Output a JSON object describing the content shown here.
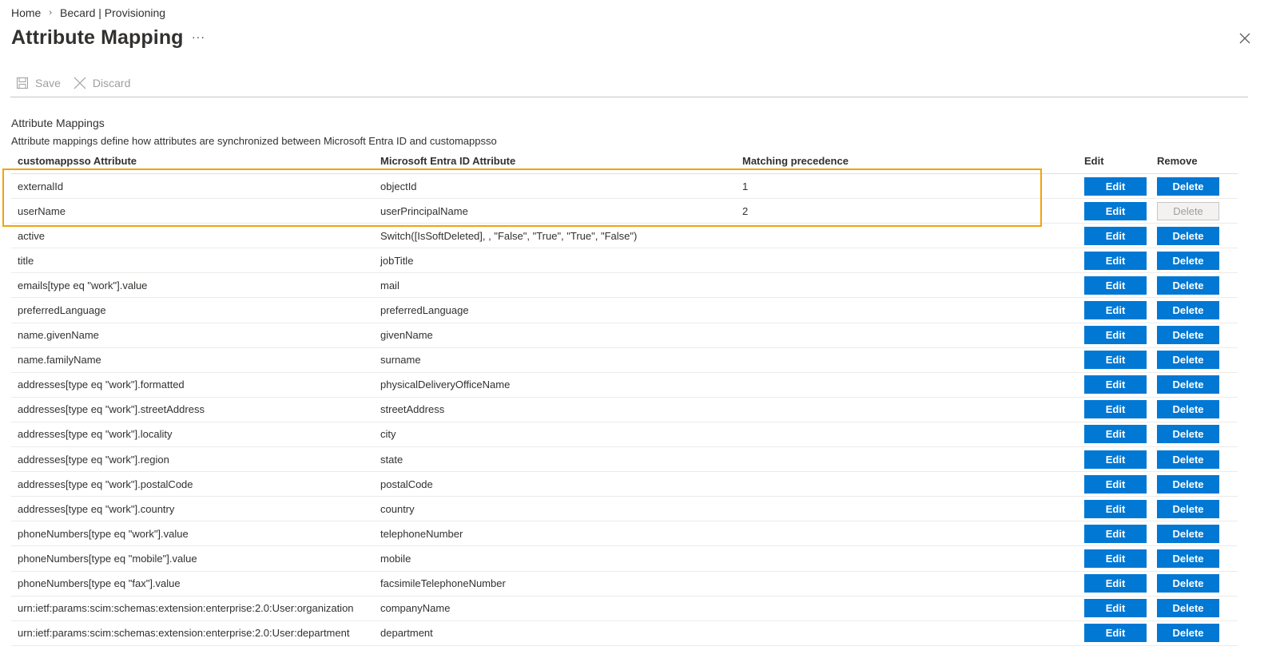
{
  "breadcrumb": [
    {
      "label": "Home"
    },
    {
      "label": "Becard | Provisioning"
    }
  ],
  "page": {
    "title": "Attribute Mapping",
    "more_label": "···"
  },
  "toolbar": {
    "save_label": "Save",
    "discard_label": "Discard",
    "save_icon": "save-icon",
    "discard_icon": "close-icon"
  },
  "section": {
    "title": "Attribute Mappings",
    "description": "Attribute mappings define how attributes are synchronized between Microsoft Entra ID and customappsso"
  },
  "table": {
    "headers": {
      "source": "customappsso Attribute",
      "target": "Microsoft Entra ID Attribute",
      "precedence": "Matching precedence",
      "edit": "Edit",
      "remove": "Remove"
    },
    "edit_label": "Edit",
    "delete_label": "Delete",
    "rows": [
      {
        "source": "externalId",
        "target": "objectId",
        "precedence": "1",
        "delete_disabled": false
      },
      {
        "source": "userName",
        "target": "userPrincipalName",
        "precedence": "2",
        "delete_disabled": true
      },
      {
        "source": "active",
        "target": "Switch([IsSoftDeleted], , \"False\", \"True\", \"True\", \"False\")",
        "precedence": "",
        "delete_disabled": false
      },
      {
        "source": "title",
        "target": "jobTitle",
        "precedence": "",
        "delete_disabled": false
      },
      {
        "source": "emails[type eq \"work\"].value",
        "target": "mail",
        "precedence": "",
        "delete_disabled": false
      },
      {
        "source": "preferredLanguage",
        "target": "preferredLanguage",
        "precedence": "",
        "delete_disabled": false
      },
      {
        "source": "name.givenName",
        "target": "givenName",
        "precedence": "",
        "delete_disabled": false
      },
      {
        "source": "name.familyName",
        "target": "surname",
        "precedence": "",
        "delete_disabled": false
      },
      {
        "source": "addresses[type eq \"work\"].formatted",
        "target": "physicalDeliveryOfficeName",
        "precedence": "",
        "delete_disabled": false
      },
      {
        "source": "addresses[type eq \"work\"].streetAddress",
        "target": "streetAddress",
        "precedence": "",
        "delete_disabled": false
      },
      {
        "source": "addresses[type eq \"work\"].locality",
        "target": "city",
        "precedence": "",
        "delete_disabled": false
      },
      {
        "source": "addresses[type eq \"work\"].region",
        "target": "state",
        "precedence": "",
        "delete_disabled": false
      },
      {
        "source": "addresses[type eq \"work\"].postalCode",
        "target": "postalCode",
        "precedence": "",
        "delete_disabled": false
      },
      {
        "source": "addresses[type eq \"work\"].country",
        "target": "country",
        "precedence": "",
        "delete_disabled": false
      },
      {
        "source": "phoneNumbers[type eq \"work\"].value",
        "target": "telephoneNumber",
        "precedence": "",
        "delete_disabled": false
      },
      {
        "source": "phoneNumbers[type eq \"mobile\"].value",
        "target": "mobile",
        "precedence": "",
        "delete_disabled": false
      },
      {
        "source": "phoneNumbers[type eq \"fax\"].value",
        "target": "facsimileTelephoneNumber",
        "precedence": "",
        "delete_disabled": false
      },
      {
        "source": "urn:ietf:params:scim:schemas:extension:enterprise:2.0:User:organization",
        "target": "companyName",
        "precedence": "",
        "delete_disabled": false
      },
      {
        "source": "urn:ietf:params:scim:schemas:extension:enterprise:2.0:User:department",
        "target": "department",
        "precedence": "",
        "delete_disabled": false
      }
    ]
  },
  "colors": {
    "accent": "#0078d4",
    "highlight": "#f0a30a"
  }
}
